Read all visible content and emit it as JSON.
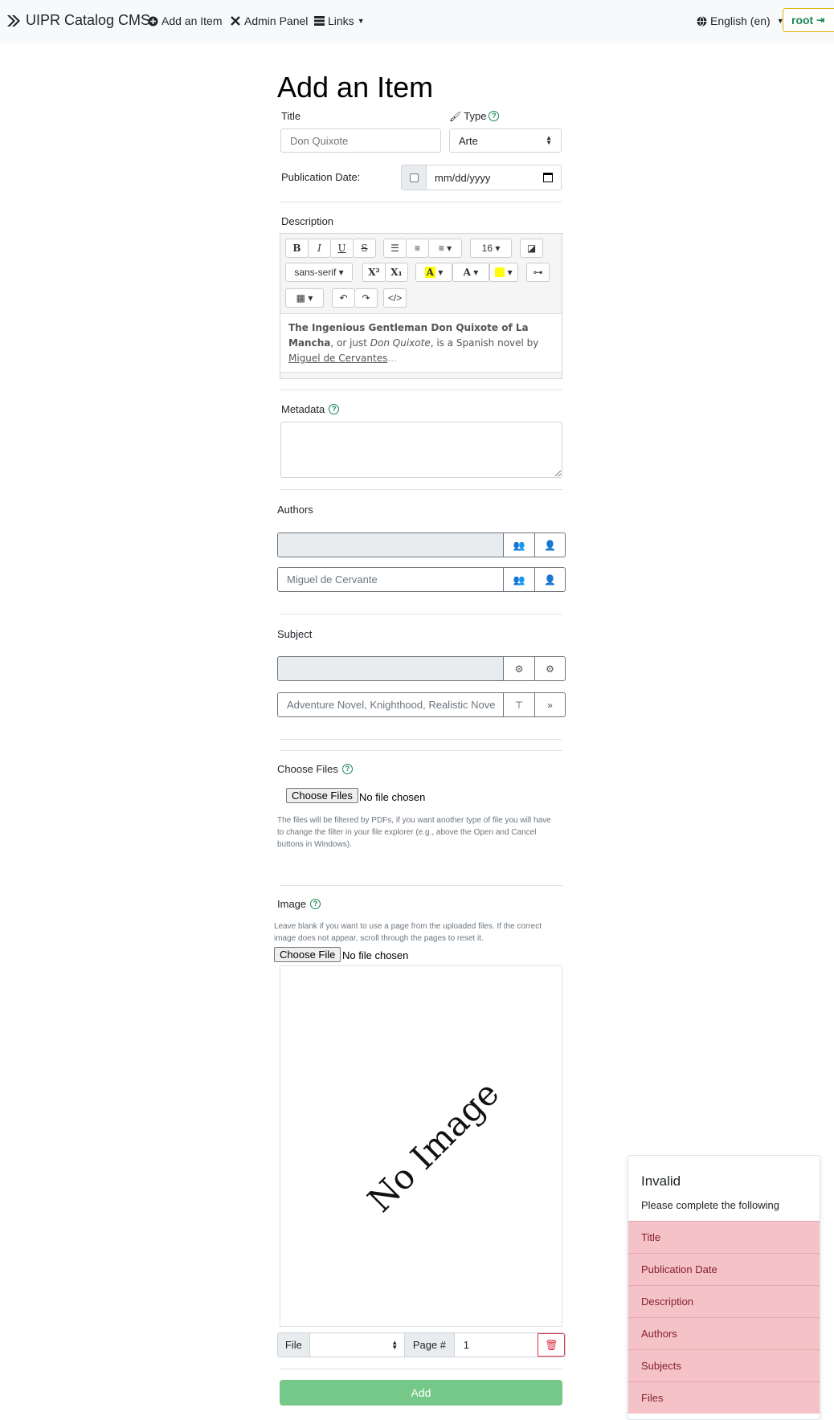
{
  "navbar": {
    "brand": "UIPR Catalog CMS",
    "add_item": "Add an Item",
    "admin_panel": "Admin Panel",
    "links": "Links",
    "language": "English (en)",
    "user": "root"
  },
  "page": {
    "title": "Add an Item"
  },
  "form": {
    "title_label": "Title",
    "title_placeholder": "Don Quixote",
    "type_label": "Type",
    "type_value": "Arte",
    "pubdate_label": "Publication Date:",
    "pubdate_placeholder": "mm/dd/yyyy",
    "description_label": "Description",
    "editor": {
      "font_size": "16",
      "font_family": "sans-serif",
      "content_bold": "The Ingenious Gentleman Don Quixote of La Mancha",
      "content_mid": ", or just ",
      "content_italic": "Don Quixote",
      "content_rest": ", is a Spanish novel by ",
      "content_link": "Miguel de Cervantes",
      "content_ellipsis": "..."
    },
    "metadata_label": "Metadata",
    "authors_label": "Authors",
    "authors_placeholder": "Miguel de Cervante",
    "subject_label": "Subject",
    "subject_placeholder": "Adventure Novel, Knighthood, Realistic Nove",
    "files_label": "Choose Files",
    "files_button": "Choose Files",
    "files_status": "No file chosen",
    "files_help": "The files will be filtered by PDFs, if you want another type of file you will have to change the filter in your file explorer (e.g., above the Open and Cancel buttons in Windows).",
    "image_label": "Image",
    "image_help": "Leave blank if you want to use a page from the uploaded files. If the correct image does not appear, scroll through the pages to reset it.",
    "image_button": "Choose File",
    "image_status": "No file chosen",
    "no_image_text": "No Image",
    "file_label": "File",
    "page_label": "Page #",
    "page_value": "1",
    "add_button": "Add"
  },
  "toast": {
    "title": "Invalid",
    "message": "Please complete the following",
    "items": [
      "Title",
      "Publication Date",
      "Description",
      "Authors",
      "Subjects",
      "Files"
    ]
  },
  "colors": {
    "success": "#198754",
    "danger_bg": "#f5c2c7",
    "add_button": "#75c887"
  }
}
